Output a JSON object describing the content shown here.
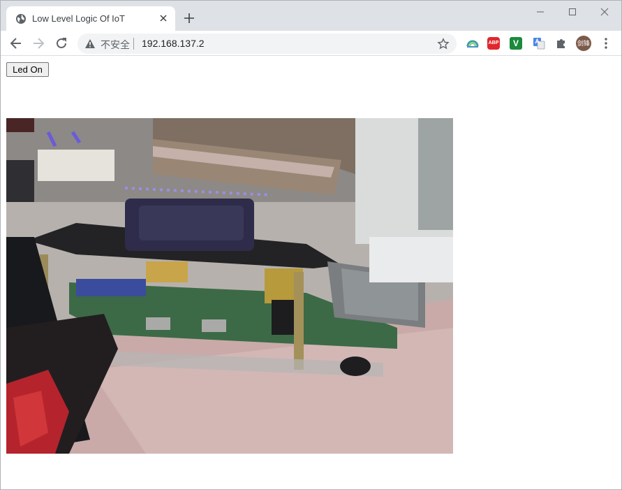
{
  "browser": {
    "tab_title": "Low Level Logic Of IoT",
    "security_label": "不安全",
    "url": "192.168.137.2",
    "profile_initials": "剑锋",
    "extensions": [
      "rainbow-extension-icon",
      "adblock-plus-icon",
      "v-extension-icon",
      "google-translate-icon",
      "extensions-puzzle-icon"
    ]
  },
  "page": {
    "button_label": "Led On",
    "camera_feed": "camera-feed-image"
  },
  "colors": {
    "tabstrip": "#dee1e6",
    "omnibox": "#f1f3f4",
    "abp_red": "#e0272e",
    "v_green": "#1a8a3c"
  }
}
